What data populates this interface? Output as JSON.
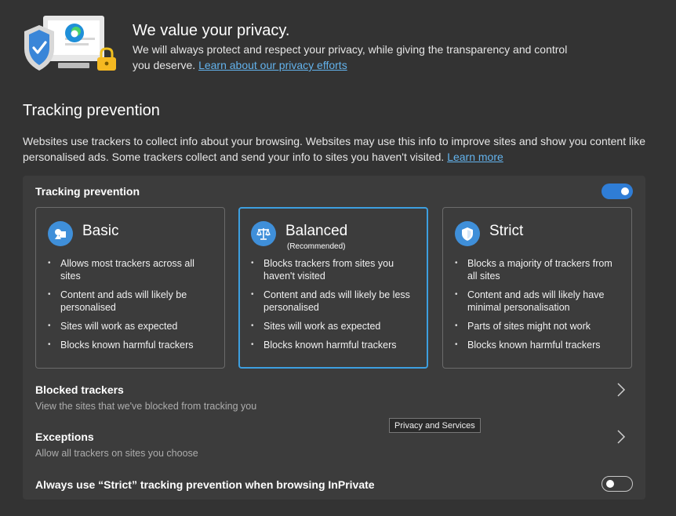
{
  "header": {
    "title": "We value your privacy.",
    "text": "We will always protect and respect your privacy, while giving the transparency and control you deserve.",
    "link": "Learn about our privacy efforts"
  },
  "tracking": {
    "title": "Tracking prevention",
    "description": "Websites use trackers to collect info about your browsing. Websites may use this info to improve sites and show you content like personalised ads. Some trackers collect and send your info to sites you haven't visited.",
    "learn_more": "Learn more",
    "toggle_label": "Tracking prevention",
    "toggle_on": true
  },
  "options": [
    {
      "title": "Basic",
      "subtitle": "",
      "icon": "basic-shapes-icon",
      "selected": false,
      "bullets": [
        "Allows most trackers across all sites",
        "Content and ads will likely be personalised",
        "Sites will work as expected",
        "Blocks known harmful trackers"
      ]
    },
    {
      "title": "Balanced",
      "subtitle": "(Recommended)",
      "icon": "scales-icon",
      "selected": true,
      "bullets": [
        "Blocks trackers from sites you haven't visited",
        "Content and ads will likely be less personalised",
        "Sites will work as expected",
        "Blocks known harmful trackers"
      ]
    },
    {
      "title": "Strict",
      "subtitle": "",
      "icon": "shield-icon",
      "selected": false,
      "bullets": [
        "Blocks a majority of trackers from all sites",
        "Content and ads will likely have minimal personalisation",
        "Parts of sites might not work",
        "Blocks known harmful trackers"
      ]
    }
  ],
  "blocked": {
    "title": "Blocked trackers",
    "subtitle": "View the sites that we've blocked from tracking you"
  },
  "exceptions": {
    "title": "Exceptions",
    "subtitle": "Allow all trackers on sites you choose"
  },
  "inprivate": {
    "label": "Always use “Strict” tracking prevention when browsing InPrivate",
    "toggle_on": false
  },
  "tooltip": "Privacy and Services",
  "colors": {
    "background": "#333333",
    "card": "#3c3c3c",
    "accent": "#3d9fe0",
    "toggle_on": "#2f7dd6",
    "link": "#63b3ed"
  }
}
